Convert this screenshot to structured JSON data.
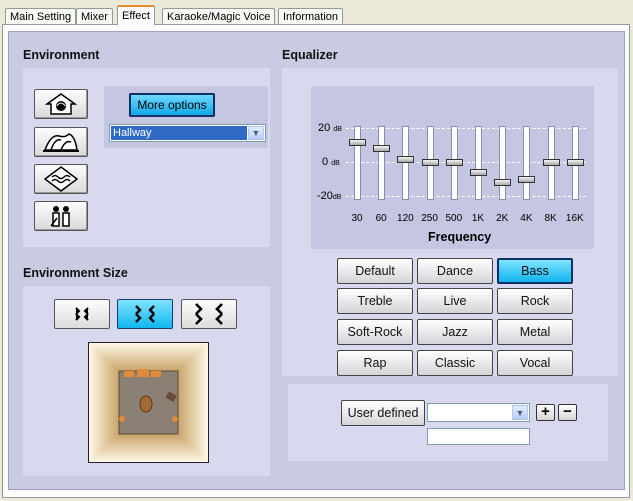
{
  "tabs": [
    {
      "label": "Main Setting"
    },
    {
      "label": "Mixer"
    },
    {
      "label": "Effect",
      "active": true
    },
    {
      "label": "Karaoke/Magic Voice"
    },
    {
      "label": "Information"
    }
  ],
  "environment": {
    "title": "Environment",
    "icons": [
      "house-icon",
      "concert-hall-icon",
      "underwater-icon",
      "people-icon"
    ],
    "more_options_label": "More options",
    "selected_environment": "Hallway"
  },
  "environment_size": {
    "title": "Environment Size",
    "sizes": [
      "small",
      "medium",
      "large"
    ],
    "selected": "medium"
  },
  "equalizer": {
    "title": "Equalizer",
    "db_labels": {
      "top": "20",
      "mid": "0",
      "bottom": "-20",
      "unit": "dB"
    },
    "frequency_label": "Frequency",
    "bands": [
      {
        "freq": "30",
        "gain_db": 12
      },
      {
        "freq": "60",
        "gain_db": 8
      },
      {
        "freq": "120",
        "gain_db": 2
      },
      {
        "freq": "250",
        "gain_db": 0
      },
      {
        "freq": "500",
        "gain_db": 0
      },
      {
        "freq": "1K",
        "gain_db": -6
      },
      {
        "freq": "2K",
        "gain_db": -12
      },
      {
        "freq": "4K",
        "gain_db": -10
      },
      {
        "freq": "8K",
        "gain_db": 0
      },
      {
        "freq": "16K",
        "gain_db": 0
      }
    ],
    "presets": [
      "Default",
      "Dance",
      "Bass",
      "Treble",
      "Live",
      "Rock",
      "Soft-Rock",
      "Jazz",
      "Metal",
      "Rap",
      "Classic",
      "Vocal"
    ],
    "active_preset": "Bass",
    "user_defined_label": "User defined",
    "user_preset_value": "",
    "user_preset_name": ""
  },
  "colors": {
    "accent": "#11b5ef",
    "panel": "#c9cbe3"
  }
}
